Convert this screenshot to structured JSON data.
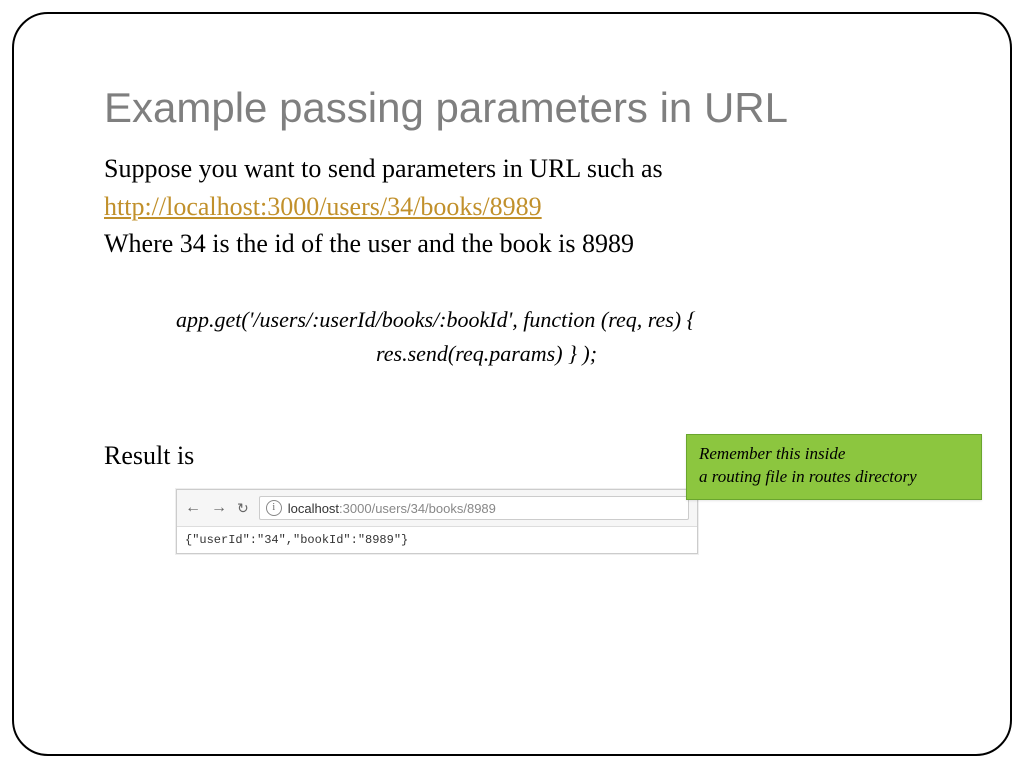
{
  "title": "Example passing parameters in URL",
  "intro_line": "Suppose you want to send parameters in URL such as",
  "example_url": "http://localhost:3000/users/34/books/8989",
  "explain_line": "Where 34 is the id of the user  and the book is 8989",
  "code": {
    "line1": "app.get('/users/:userId/books/:bookId', function (req, res) {",
    "line2": "res.send(req.params) } );"
  },
  "callout": {
    "line1": "Remember this inside",
    "line2": "a routing file in routes directory"
  },
  "result_label": "Result is",
  "browser": {
    "info_glyph": "i",
    "host": "localhost",
    "path": ":3000/users/34/books/8989",
    "response": "{\"userId\":\"34\",\"bookId\":\"8989\"}"
  }
}
